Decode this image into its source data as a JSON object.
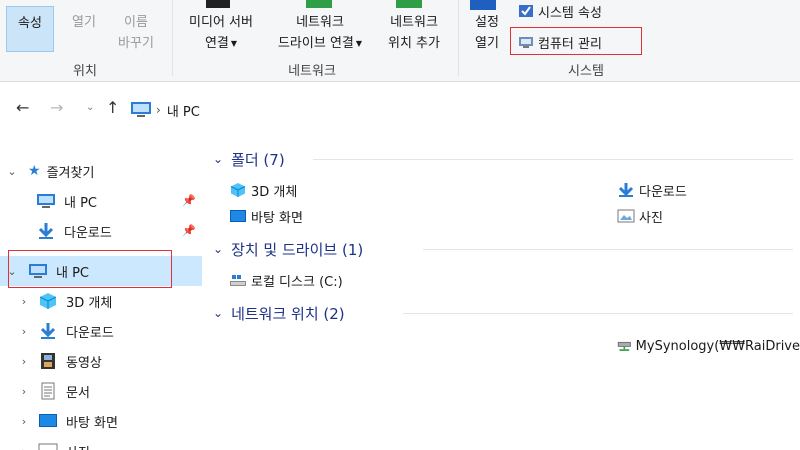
{
  "ribbon": {
    "location": {
      "properties": "속성",
      "open": "열기",
      "rename_line1": "이름",
      "rename_line2": "바꾸기",
      "group": "위치"
    },
    "network": {
      "map_media_line1": "미디어 서버",
      "map_media_line2": "연결",
      "map_drive_line1": "네트워크",
      "map_drive_line2": "드라이브 연결",
      "add_location_line1": "네트워크",
      "add_location_line2": "위치 추가",
      "group": "네트워크"
    },
    "system": {
      "open_settings_line1": "설정",
      "open_settings_line2": "열기",
      "system_properties": "시스템 속성",
      "computer_management": "컴퓨터 관리",
      "group": "시스템"
    }
  },
  "address": {
    "location": "내 PC"
  },
  "nav": {
    "quick_access": "즐겨찾기",
    "qa_items": [
      "내 PC",
      "다운로드"
    ],
    "this_pc": "내 PC",
    "pc_items": [
      "3D 개체",
      "다운로드",
      "동영상",
      "문서",
      "바탕 화면",
      "사진"
    ]
  },
  "main": {
    "folders_header": "폴더 (7)",
    "folders": [
      "3D 개체",
      "다운로드",
      "바탕 화면",
      "사진"
    ],
    "devices_header": "장치 및 드라이브 (1)",
    "devices": [
      "로컬 디스크 (C:)"
    ],
    "netloc_header": "네트워크 위치 (2)",
    "netlocs": [
      "MySynology(₩₩RaiDrive"
    ]
  },
  "colors": {
    "accent": "#1e3287",
    "selection": "#cce8ff",
    "highlight": "#e0303a"
  }
}
